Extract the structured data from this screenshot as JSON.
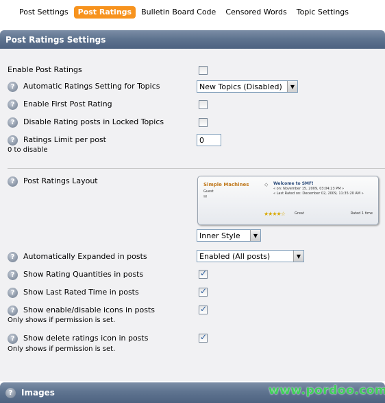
{
  "tabs": [
    "Post Settings",
    "Post Ratings",
    "Bulletin Board Code",
    "Censored Words",
    "Topic Settings"
  ],
  "active_tab": "Post Ratings",
  "section_title": "Post Ratings Settings",
  "settings": {
    "enable_ratings": {
      "label": "Enable Post Ratings",
      "checked": false
    },
    "auto_setting": {
      "label": "Automatic Ratings Setting for Topics",
      "value": "New Topics (Disabled)"
    },
    "first_post": {
      "label": "Enable First Post Rating",
      "checked": false
    },
    "locked": {
      "label": "Disable Rating posts in Locked Topics",
      "checked": false
    },
    "limit": {
      "label": "Ratings Limit per post",
      "sub": "0 to disable",
      "value": "0"
    },
    "layout": {
      "label": "Post Ratings Layout",
      "value": "Inner Style"
    },
    "expanded": {
      "label": "Automatically Expanded in posts",
      "value": "Enabled (All posts)"
    },
    "quantities": {
      "label": "Show Rating Quantities in posts",
      "checked": true
    },
    "last_rated": {
      "label": "Show Last Rated Time in posts",
      "checked": true
    },
    "enable_icons": {
      "label": "Show enable/disable icons in posts",
      "sub": "Only shows if permission is set.",
      "checked": true
    },
    "delete_icon": {
      "label": "Show delete ratings icon in posts",
      "sub": "Only shows if permission is set.",
      "checked": true
    }
  },
  "preview": {
    "site": "Simple Machines",
    "guest": "Guest",
    "title": "Welcome to SMF!",
    "on": "« on: November 15, 2009, 03:04:23 PM »",
    "last_rated": "« Last Rated on: December 02, 2009, 11:35:20 AM »",
    "stars": "★★★★☆",
    "rating_word": "Great",
    "rated": "Rated 1 time"
  },
  "next_section": "Images",
  "watermark": "www.pordoo.com",
  "help_glyph": "?"
}
